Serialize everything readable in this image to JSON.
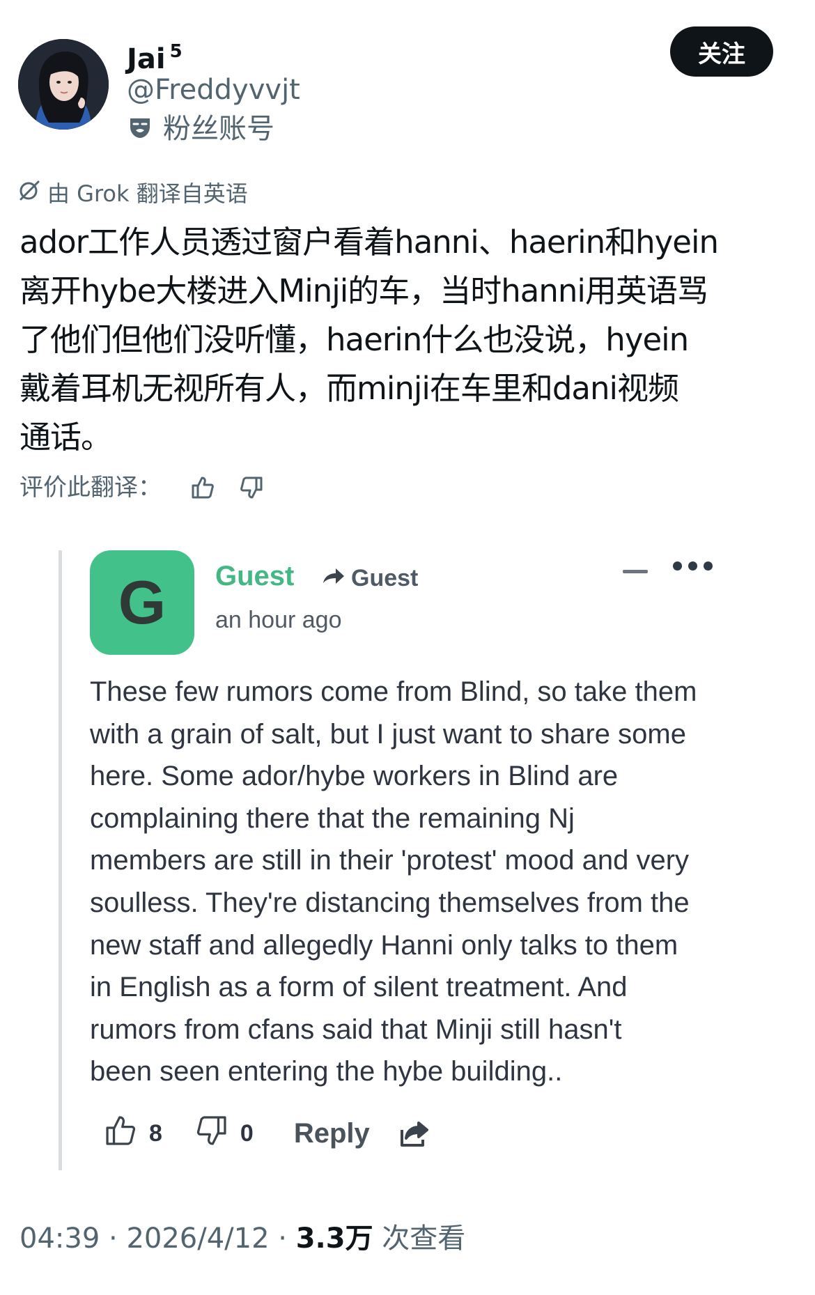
{
  "author": {
    "display_name": "Jai",
    "badge_number": "5",
    "handle": "@Freddyvvjt",
    "account_label": "粉丝账号",
    "follow_label": "关注"
  },
  "translation": {
    "source_label": "由 Grok 翻译自英语",
    "text": "ador工作人员透过窗户看着hanni、haerin和hyein\n离开hybe大楼进入Minji的车，当时hanni用英语骂\n了他们但他们没听懂，haerin什么也没说，hyein\n戴着耳机无视所有人，而minji在车里和dani视频\n通话。",
    "rate_label": "评价此翻译："
  },
  "comment": {
    "avatar_letter": "G",
    "author": "Guest",
    "reply_to": "Guest",
    "time": "an hour ago",
    "lines": [
      "These few rumors come from Blind, so take them",
      "with a grain of salt, but I just want to share some",
      "here. Some ador/hybe workers in Blind are",
      "complaining there that the remaining Nj",
      "members are still in their 'protest' mood and very",
      "soulless. They're distancing themselves from the",
      "new staff and allegedly Hanni only talks to them",
      "in English as a form of silent treatment. And",
      "rumors from cfans said that Minji still hasn't",
      "been seen entering the hybe building.."
    ],
    "likes": "8",
    "dislikes": "0",
    "reply_label": "Reply"
  },
  "post_meta": {
    "time": "04:39",
    "sep1": " · ",
    "date": "2026/4/12",
    "sep2": " · ",
    "views": "3.3万",
    "views_label": " 次查看"
  },
  "colors": {
    "guest_accent": "#43c18a",
    "text_primary": "#0f1419",
    "text_secondary": "#536471"
  },
  "icons": [
    "theater-mask-icon",
    "grok-icon",
    "thumbs-up-icon",
    "thumbs-down-icon",
    "forward-arrow-icon",
    "share-icon",
    "more-dots-icon",
    "collapse-icon"
  ]
}
